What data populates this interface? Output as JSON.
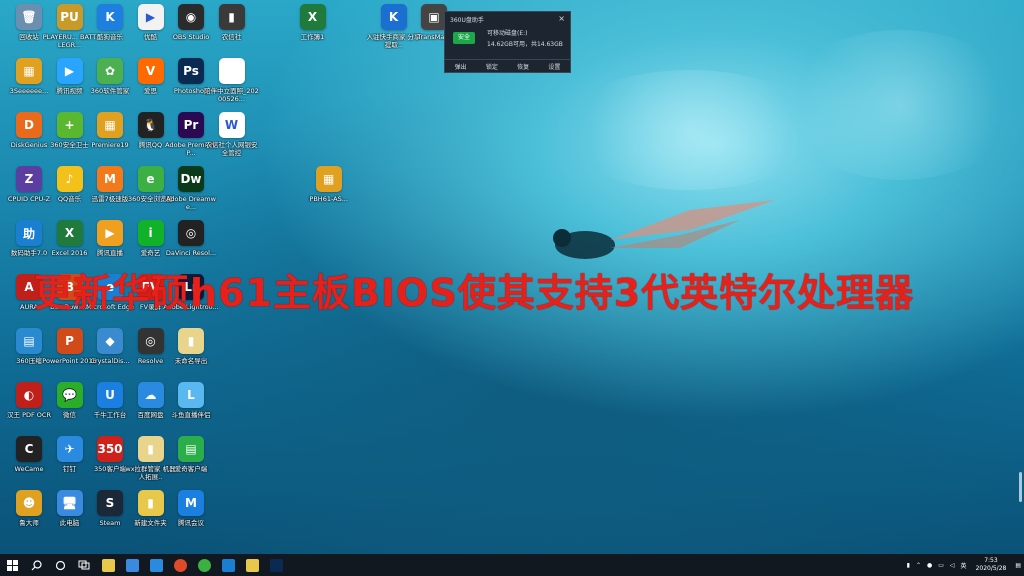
{
  "headline": "更新华硕h61主板BIOS使其支持3代英特尔处理器",
  "icons": [
    {
      "label": "回收站",
      "color": "#6b8fb0",
      "glyph": "🗑",
      "col": 0,
      "row": 0
    },
    {
      "label": "PLAYERU... BATTLEGR...",
      "color": "#c79a2a",
      "glyph": "PU",
      "col": 1,
      "row": 0
    },
    {
      "label": "酷狗音乐",
      "color": "#1e7fe0",
      "glyph": "K",
      "col": 2,
      "row": 0
    },
    {
      "label": "优酷",
      "color": "#f2f2f2",
      "glyph": "▶",
      "col": 3,
      "row": 0
    },
    {
      "label": "OBS Studio",
      "color": "#2b2b2b",
      "glyph": "◉",
      "col": 4,
      "row": 0
    },
    {
      "label": "农信社",
      "color": "#3a3a3a",
      "glyph": "▮",
      "col": 5,
      "row": 0
    },
    {
      "label": "工作簿1",
      "color": "#1f7a3c",
      "glyph": "X",
      "col": 7,
      "row": 0
    },
    {
      "label": "入驻快手商家 分享提取..",
      "color": "#1a6fd0",
      "glyph": "K",
      "col": 9,
      "row": 0
    },
    {
      "label": "TransMa...",
      "color": "#444",
      "glyph": "▣",
      "col": 10,
      "row": 0
    },
    {
      "label": "3Seeeeee...",
      "color": "#e0a020",
      "glyph": "▦",
      "col": 0,
      "row": 1
    },
    {
      "label": "腾讯视频",
      "color": "#2aa5ff",
      "glyph": "▶",
      "col": 1,
      "row": 1
    },
    {
      "label": "360软件管家",
      "color": "#4caf50",
      "glyph": "✿",
      "col": 2,
      "row": 1
    },
    {
      "label": "爱思",
      "color": "#ff6a00",
      "glyph": "V",
      "col": 3,
      "row": 1
    },
    {
      "label": "Photoshop",
      "color": "#0a2a52",
      "glyph": "Ps",
      "col": 4,
      "row": 1
    },
    {
      "label": "陪伴中立面照_20200526...",
      "color": "#ffffff",
      "glyph": "",
      "col": 5,
      "row": 1
    },
    {
      "label": "DiskGenius",
      "color": "#e86a1a",
      "glyph": "D",
      "col": 0,
      "row": 2
    },
    {
      "label": "360安全卫士",
      "color": "#59b82f",
      "glyph": "+",
      "col": 1,
      "row": 2
    },
    {
      "label": "Premiere19",
      "color": "#e0a020",
      "glyph": "▦",
      "col": 2,
      "row": 2
    },
    {
      "label": "腾讯QQ",
      "color": "#222",
      "glyph": "🐧",
      "col": 3,
      "row": 2
    },
    {
      "label": "Adobe Premiere P...",
      "color": "#2a0a52",
      "glyph": "Pr",
      "col": 4,
      "row": 2
    },
    {
      "label": "农信社个人网银安全管控",
      "color": "#ffffff",
      "glyph": "W",
      "col": 5,
      "row": 2
    },
    {
      "label": "CPUID CPU-Z",
      "color": "#5a3fa0",
      "glyph": "Z",
      "col": 0,
      "row": 3
    },
    {
      "label": "QQ音乐",
      "color": "#f2c21a",
      "glyph": "♪",
      "col": 1,
      "row": 3
    },
    {
      "label": "迅雷7极速版",
      "color": "#f27a1a",
      "glyph": "M",
      "col": 2,
      "row": 3
    },
    {
      "label": "360安全浏览器",
      "color": "#3cb043",
      "glyph": "e",
      "col": 3,
      "row": 3
    },
    {
      "label": "Adobe Dreamwe...",
      "color": "#0a3a1a",
      "glyph": "Dw",
      "col": 4,
      "row": 3
    },
    {
      "label": "PBH61-AS...",
      "color": "#e0a020",
      "glyph": "▦",
      "col": 7.4,
      "row": 3
    },
    {
      "label": "数码助手7.0",
      "color": "#1a7fd0",
      "glyph": "助",
      "col": 0,
      "row": 4
    },
    {
      "label": "Excel 2016",
      "color": "#1f7a3c",
      "glyph": "X",
      "col": 1,
      "row": 4
    },
    {
      "label": "腾讯直播",
      "color": "#f0a020",
      "glyph": "▶",
      "col": 2,
      "row": 4
    },
    {
      "label": "爱奇艺",
      "color": "#12b12a",
      "glyph": "i",
      "col": 3,
      "row": 4
    },
    {
      "label": "DaVinci Resol...",
      "color": "#222",
      "glyph": "◎",
      "col": 4,
      "row": 4
    },
    {
      "label": "AURA",
      "color": "#c0201a",
      "glyph": "A",
      "col": 0,
      "row": 5
    },
    {
      "label": "Bus Down...",
      "color": "#d24a1a",
      "glyph": "B",
      "col": 1,
      "row": 5
    },
    {
      "label": "Microsoft Edge",
      "color": "#1a7fd0",
      "glyph": "e",
      "col": 2,
      "row": 5
    },
    {
      "label": "FV录屏",
      "color": "#d0201a",
      "glyph": "FV",
      "col": 3,
      "row": 5
    },
    {
      "label": "Adobe Lightroo...",
      "color": "#0a1a3a",
      "glyph": "Lr",
      "col": 4,
      "row": 5
    },
    {
      "label": "360压缩",
      "color": "#2a8ad0",
      "glyph": "▤",
      "col": 0,
      "row": 6
    },
    {
      "label": "PowerPoint 2016",
      "color": "#d04a1a",
      "glyph": "P",
      "col": 1,
      "row": 6
    },
    {
      "label": "CrystalDis...",
      "color": "#3a8ad0",
      "glyph": "◆",
      "col": 2,
      "row": 6
    },
    {
      "label": "Resolve",
      "color": "#333",
      "glyph": "◎",
      "col": 3,
      "row": 6
    },
    {
      "label": "未命名导出",
      "color": "#e8d48a",
      "glyph": "▮",
      "col": 4,
      "row": 6
    },
    {
      "label": "汉王 PDF OCR",
      "color": "#c0201a",
      "glyph": "◐",
      "col": 0,
      "row": 7
    },
    {
      "label": "微信",
      "color": "#2aae2a",
      "glyph": "💬",
      "col": 1,
      "row": 7
    },
    {
      "label": "千牛工作台",
      "color": "#1a7fe0",
      "glyph": "U",
      "col": 2,
      "row": 7
    },
    {
      "label": "百度网盘",
      "color": "#2a8ae0",
      "glyph": "☁",
      "col": 3,
      "row": 7
    },
    {
      "label": "斗鱼直播伴侣",
      "color": "#5ab8f0",
      "glyph": "L",
      "col": 4,
      "row": 7
    },
    {
      "label": "WeCame",
      "color": "#222",
      "glyph": "C",
      "col": 0,
      "row": 8
    },
    {
      "label": "钉钉",
      "color": "#2a8ae0",
      "glyph": "✈",
      "col": 1,
      "row": 8
    },
    {
      "label": "350客户端",
      "color": "#d0201a",
      "glyph": "350",
      "col": 2,
      "row": 8
    },
    {
      "label": "wx拉群管家 机器人拓展..",
      "color": "#e8d48a",
      "glyph": "▮",
      "col": 3,
      "row": 8
    },
    {
      "label": "爱奇客户端",
      "color": "#2aae4a",
      "glyph": "▤",
      "col": 4,
      "row": 8
    },
    {
      "label": "鲁大师",
      "color": "#e0a020",
      "glyph": "☻",
      "col": 0,
      "row": 9
    },
    {
      "label": "此电脑",
      "color": "#3a8ae0",
      "glyph": "🖥",
      "col": 1,
      "row": 9
    },
    {
      "label": "Steam",
      "color": "#1b2838",
      "glyph": "S",
      "col": 2,
      "row": 9
    },
    {
      "label": "新建文件夹",
      "color": "#e8c84a",
      "glyph": "▮",
      "col": 3,
      "row": 9
    },
    {
      "label": "腾讯会议",
      "color": "#1a7fe0",
      "glyph": "M",
      "col": 4,
      "row": 9
    }
  ],
  "popup": {
    "title": "360U盘助手",
    "close": "×",
    "safe_badge": "安全",
    "line1": "可移动磁盘(E:)",
    "line2": "14.62GB可用，共14.63GB",
    "actions": [
      "弹出",
      "锁定",
      "恢复",
      "设置"
    ]
  },
  "taskbar": {
    "start_icon": "windows-start-icon",
    "search_icon": "search-icon",
    "cortana_icon": "cortana-icon",
    "taskview_icon": "task-view-icon",
    "pinned": [
      {
        "name": "file-explorer",
        "color": "#e8c84a"
      },
      {
        "name": "store",
        "color": "#3a8ae0"
      },
      {
        "name": "mail",
        "color": "#2a8ae0"
      },
      {
        "name": "chrome",
        "color": "#e04a2a"
      },
      {
        "name": "360-browser",
        "color": "#3cb043"
      },
      {
        "name": "edge",
        "color": "#1a7fd0"
      },
      {
        "name": "explorer-window",
        "color": "#e8c84a"
      },
      {
        "name": "photoshop",
        "color": "#0a2a52"
      }
    ],
    "ime": "英",
    "time": "7:53",
    "date": "2020/5/28"
  }
}
